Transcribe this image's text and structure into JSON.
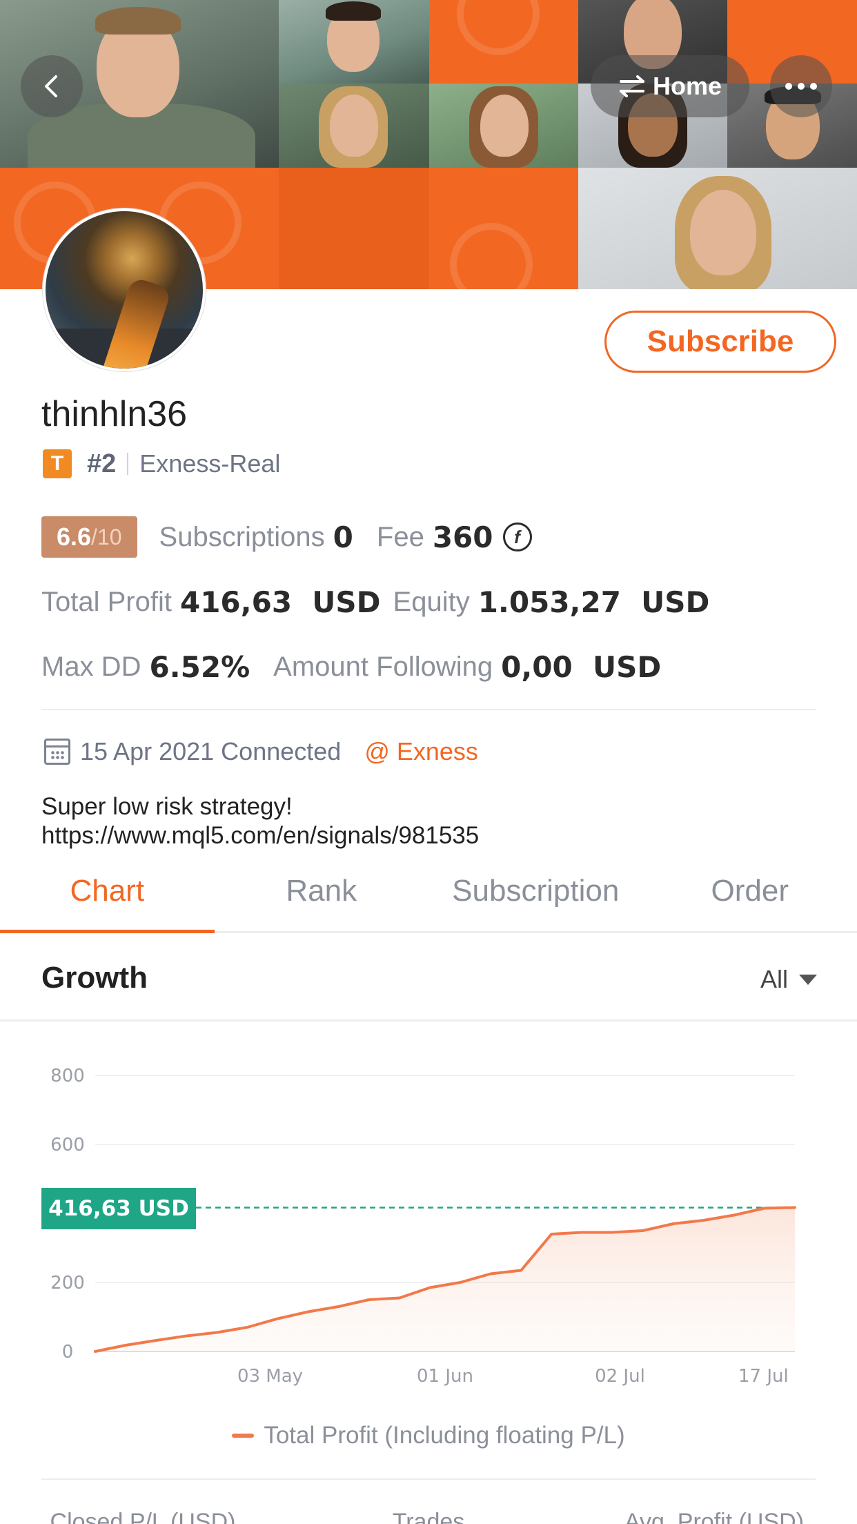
{
  "nav": {
    "home_label": "Home",
    "back_icon": "chevron-left-icon",
    "more_icon": "more-icon"
  },
  "profile": {
    "subscribe_label": "Subscribe",
    "username": "thinhln36",
    "badge_letter": "T",
    "rank": "#2",
    "server": "Exness-Real",
    "score": "6.6",
    "score_den": "/10",
    "subscriptions_label": "Subscriptions",
    "subscriptions_value": "0",
    "fee_label": "Fee",
    "fee_value": "360",
    "total_profit_label": "Total Profit",
    "total_profit_value": "416,63  USD",
    "equity_label": "Equity",
    "equity_value": "1.053,27  USD",
    "max_dd_label": "Max DD",
    "max_dd_value": "6.52%",
    "amount_following_label": "Amount Following",
    "amount_following_value": "0,00  USD",
    "connected_text": "15 Apr 2021 Connected",
    "broker": "@ Exness",
    "description_line1": "Super low risk strategy!",
    "description_line2": "https://www.mql5.com/en/signals/981535"
  },
  "tabs": [
    {
      "label": "Chart",
      "active": true
    },
    {
      "label": "Rank",
      "active": false
    },
    {
      "label": "Subscription",
      "active": false
    },
    {
      "label": "Order",
      "active": false
    }
  ],
  "growth": {
    "title": "Growth",
    "filter": "All"
  },
  "colors": {
    "accent": "#f26722",
    "tag": "#1ea687",
    "line": "#f2794a"
  },
  "chart_data": {
    "type": "area",
    "title": "",
    "ylim": [
      0,
      800
    ],
    "y_ticks": [
      "800",
      "600",
      "200",
      "0"
    ],
    "x_tick_labels": [
      "03 May",
      "01 Jun",
      "02 Jul",
      "17 Jul"
    ],
    "current_label": "416,63  USD",
    "current_value": 416.63,
    "legend_position": "bottom",
    "series": [
      {
        "name": "Total Profit (Including floating P/L)",
        "x": [
          "15 Apr",
          "20 Apr",
          "25 Apr",
          "30 Apr",
          "05 May",
          "10 May",
          "15 May",
          "20 May",
          "25 May",
          "30 May",
          "03 Jun",
          "06 Jun",
          "10 Jun",
          "13 Jun",
          "16 Jun",
          "18 Jun",
          "20 Jun",
          "25 Jun",
          "30 Jun",
          "05 Jul",
          "10 Jul",
          "15 Jul",
          "17 Jul",
          "20 Jul"
        ],
        "values": [
          0,
          18,
          32,
          45,
          55,
          70,
          95,
          115,
          130,
          150,
          155,
          185,
          200,
          225,
          235,
          340,
          345,
          345,
          350,
          370,
          380,
          395,
          415,
          417
        ]
      }
    ]
  },
  "bottom": {
    "col1": "Closed P/L (USD)",
    "col2": "Trades",
    "col3": "Avg. Profit (USD)"
  }
}
